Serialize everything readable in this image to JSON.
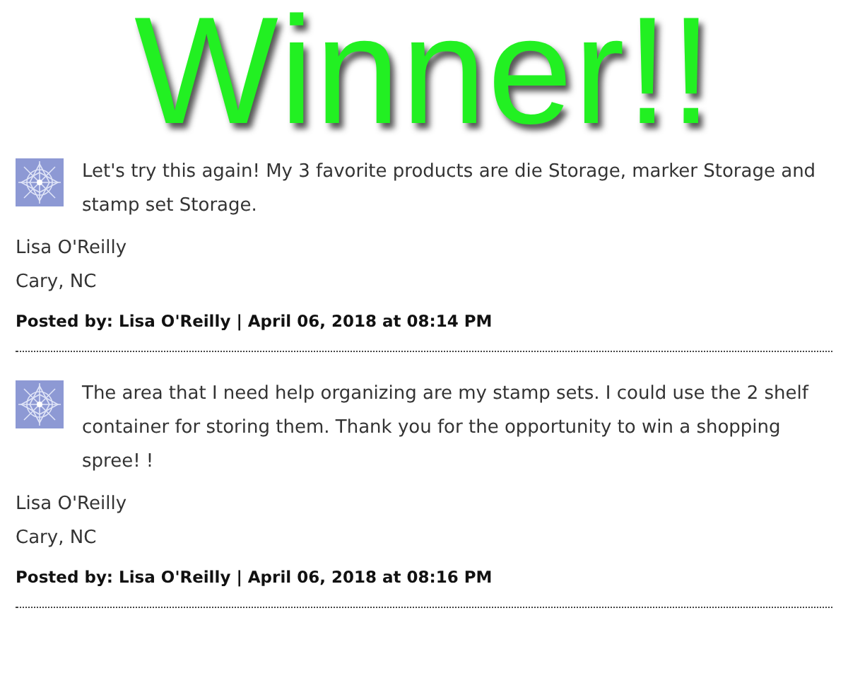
{
  "banner": {
    "text": "Winner!!"
  },
  "comments": [
    {
      "body": "Let's try this again! My 3 favorite products are die Storage, marker Storage and stamp set Storage.",
      "name": "Lisa O'Reilly",
      "location": "Cary, NC",
      "posted": "Posted by: Lisa O'Reilly | April 06, 2018 at 08:14 PM"
    },
    {
      "body": "The area that I need help organizing are my stamp sets. I could use the 2 shelf container for storing them. Thank you for the opportunity to win a shopping spree! !",
      "name": "Lisa O'Reilly",
      "location": "Cary, NC",
      "posted": "Posted by: Lisa O'Reilly | April 06, 2018 at 08:16 PM"
    }
  ]
}
